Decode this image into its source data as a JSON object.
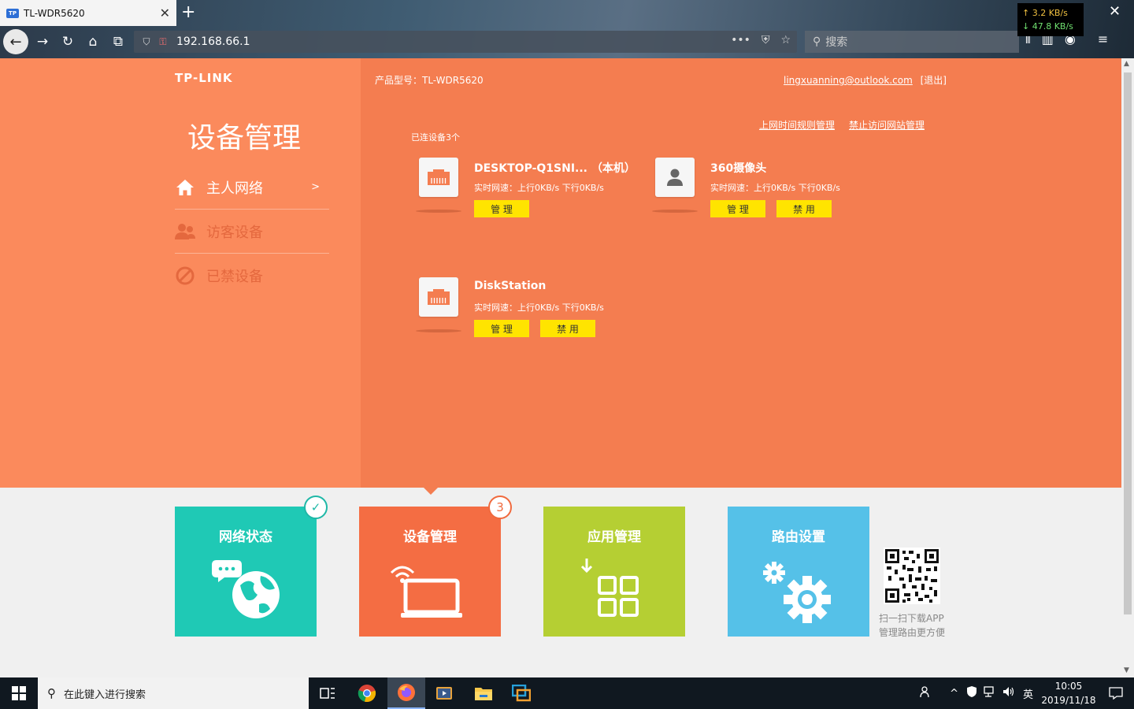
{
  "browser": {
    "tab_title": "TL-WDR5620",
    "tab_favicon": "TP",
    "url": "192.168.66.1",
    "search_placeholder": "搜索",
    "net_up": "↑ 3.2 KB/s",
    "net_down": "↓ 47.8 KB/s"
  },
  "brand": {
    "logo": "TP-LINK"
  },
  "sidebar": {
    "title": "设备管理",
    "items": [
      {
        "label": "主人网络",
        "icon": "home-icon",
        "active": true,
        "chevron": ">"
      },
      {
        "label": "访客设备",
        "icon": "guests-icon",
        "active": false
      },
      {
        "label": "已禁设备",
        "icon": "blocked-icon",
        "active": false
      }
    ]
  },
  "header": {
    "model": "产品型号：TL-WDR5620",
    "email": "lingxuanning@outlook.com",
    "logout": "[退出]",
    "links": [
      "上网时间规则管理",
      "禁止访问网站管理"
    ],
    "connected_count": "已连设备3个"
  },
  "devices": [
    {
      "name": "DESKTOP-Q1SNI... （本机）",
      "icon": "ethernet-icon",
      "speed": "实时网速：上行0KB/s 下行0KB/s",
      "manage": "管 理"
    },
    {
      "name": "360摄像头",
      "icon": "person-icon",
      "speed": "实时网速：上行0KB/s 下行0KB/s",
      "manage": "管 理",
      "block": "禁 用"
    },
    {
      "name": "DiskStation",
      "icon": "ethernet-icon",
      "speed": "实时网速：上行0KB/s 下行0KB/s",
      "manage": "管 理",
      "block": "禁 用"
    }
  ],
  "tiles": [
    {
      "label": "网络状态",
      "color": "#1fc9b5",
      "badge": "✓"
    },
    {
      "label": "设备管理",
      "color": "#f46d43",
      "badge": "3"
    },
    {
      "label": "应用管理",
      "color": "#b5cf33"
    },
    {
      "label": "路由设置",
      "color": "#55c1e8"
    }
  ],
  "qr": {
    "line1": "扫一扫下载APP",
    "line2": "管理路由更方便"
  },
  "taskbar": {
    "search_placeholder": "在此键入进行搜索",
    "ime": "英",
    "time": "10:05",
    "date": "2019/11/18"
  },
  "colors": {
    "sidebar": "#fb8a5c",
    "main": "#f47d50",
    "button": "#ffe400"
  }
}
